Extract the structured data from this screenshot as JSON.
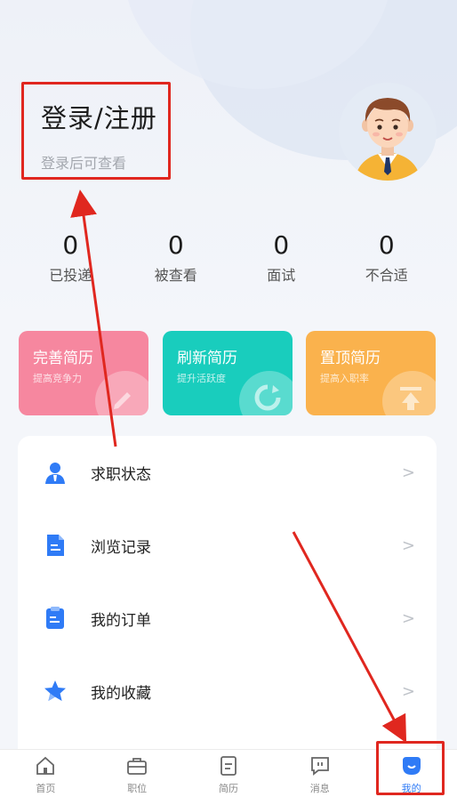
{
  "login": {
    "title": "登录/注册",
    "subtitle": "登录后可查看"
  },
  "stats": [
    {
      "value": "0",
      "label": "已投递"
    },
    {
      "value": "0",
      "label": "被查看"
    },
    {
      "value": "0",
      "label": "面试"
    },
    {
      "value": "0",
      "label": "不合适"
    }
  ],
  "cards": [
    {
      "title": "完善简历",
      "subtitle": "提高竞争力",
      "color": "#f6879f"
    },
    {
      "title": "刷新简历",
      "subtitle": "提升活跃度",
      "color": "#19cdbd"
    },
    {
      "title": "置顶简历",
      "subtitle": "提高入职率",
      "color": "#fab24d"
    }
  ],
  "menu": [
    {
      "label": "求职状态",
      "icon": "person-icon"
    },
    {
      "label": "浏览记录",
      "icon": "document-icon"
    },
    {
      "label": "我的订单",
      "icon": "clipboard-icon"
    },
    {
      "label": "我的收藏",
      "icon": "star-icon"
    }
  ],
  "chevron": ">",
  "tabs": [
    {
      "label": "首页",
      "icon": "home-icon"
    },
    {
      "label": "职位",
      "icon": "briefcase-icon"
    },
    {
      "label": "简历",
      "icon": "resume-icon"
    },
    {
      "label": "消息",
      "icon": "message-icon"
    },
    {
      "label": "我的",
      "icon": "profile-icon",
      "active": true
    }
  ],
  "colors": {
    "accent": "#2f7bf6",
    "annotation": "#e0271f"
  }
}
